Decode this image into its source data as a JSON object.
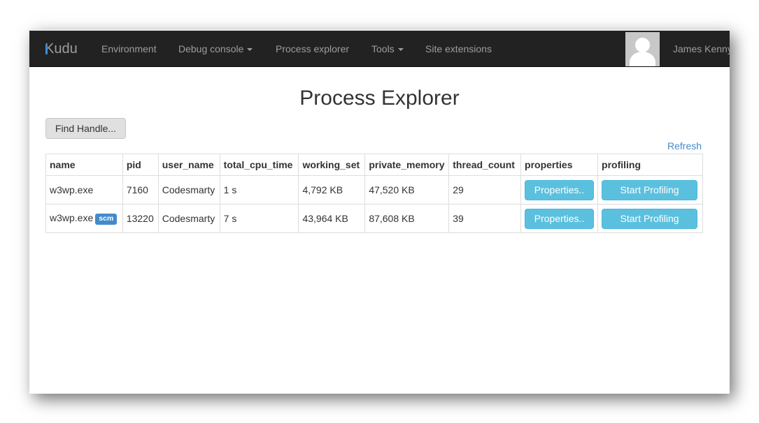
{
  "navbar": {
    "brand": "Kudu",
    "items": [
      {
        "label": "Environment",
        "dropdown": false
      },
      {
        "label": "Debug console",
        "dropdown": true
      },
      {
        "label": "Process explorer",
        "dropdown": false
      },
      {
        "label": "Tools",
        "dropdown": true
      },
      {
        "label": "Site extensions",
        "dropdown": false
      }
    ],
    "user_name": "James Kenny",
    "avatar_icon": "user-silhouette-icon"
  },
  "page": {
    "title": "Process Explorer",
    "find_handle_label": "Find Handle...",
    "refresh_label": "Refresh"
  },
  "table": {
    "columns": [
      "name",
      "pid",
      "user_name",
      "total_cpu_time",
      "working_set",
      "private_memory",
      "thread_count",
      "properties",
      "profiling"
    ],
    "rows": [
      {
        "name": "w3wp.exe",
        "badge": "",
        "pid": "7160",
        "user_name": "Codesmarty",
        "total_cpu_time": "1 s",
        "working_set": "4,792 KB",
        "private_memory": "47,520 KB",
        "thread_count": "29",
        "properties_label": "Properties..",
        "profiling_label": "Start Profiling"
      },
      {
        "name": "w3wp.exe",
        "badge": "scm",
        "pid": "13220",
        "user_name": "Codesmarty",
        "total_cpu_time": "7 s",
        "working_set": "43,964 KB",
        "private_memory": "87,608 KB",
        "thread_count": "39",
        "properties_label": "Properties..",
        "profiling_label": "Start Profiling"
      }
    ]
  },
  "colors": {
    "navbar_bg": "#222222",
    "nav_text": "#9d9d9d",
    "link": "#428bca",
    "info_button": "#5bc0de",
    "badge": "#428bca"
  }
}
